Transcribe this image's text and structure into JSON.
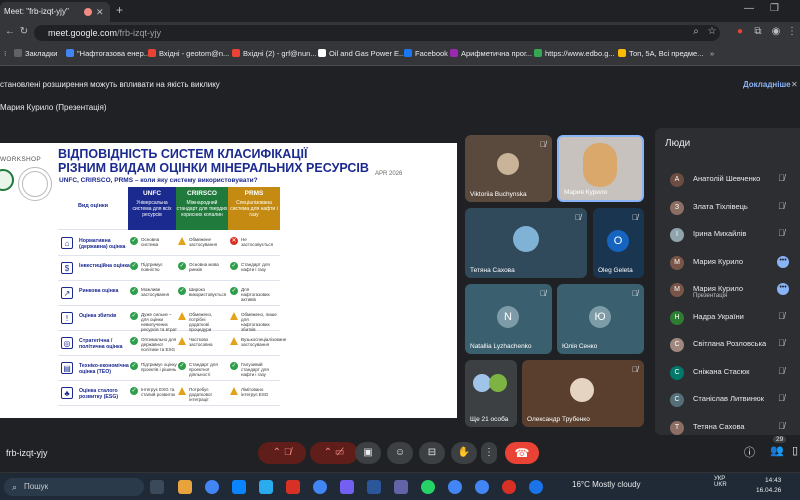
{
  "browser": {
    "tab_title": "Meet: \"frb-izqt-yjy\"",
    "url_host": "meet.google.com",
    "url_path": "/frb-izqt-yjy"
  },
  "bookmarks": [
    {
      "label": "Закладки",
      "color": "#5f6368"
    },
    {
      "label": "\"Нафтогазова енер...",
      "color": "#4285f4"
    },
    {
      "label": "Вхідні - geotom@n...",
      "color": "#ea4335"
    },
    {
      "label": "Вхідні (2) - grf@nun...",
      "color": "#ea4335"
    },
    {
      "label": "Oil and Gas Power E...",
      "color": "#ffffff"
    },
    {
      "label": "Facebook",
      "color": "#1877f2"
    },
    {
      "label": "Арифметична прог...",
      "color": "#9c27b0"
    },
    {
      "label": "https://www.edbo.g...",
      "color": "#34a853"
    },
    {
      "label": "Топ, 5А, Всі предме...",
      "color": "#fbbc04"
    }
  ],
  "notice": {
    "text": "становлені розширення можуть впливати на якість виклику",
    "more": "Докладніше",
    "close": "✕"
  },
  "presenter_label": "Мария Курило (Презентація)",
  "slide": {
    "workshop": "WORKSHOP",
    "title_line1": "ВІДПОВІДНІСТЬ СИСТЕМ КЛАСИФІКАЦІЇ",
    "title_line2": "РІЗНИМ ВИДАМ ОЦІНКИ МІНЕРАЛЬНИХ РЕСУРСІВ",
    "subtitle": "UNFC, CRIRSCO, PRMS – коли яку систему використовувати?",
    "date": "APR 2026",
    "col0": "Вид оцінки",
    "columns": [
      {
        "name": "UNFC",
        "desc": "Універсальна система для всіх ресурсів",
        "color": "#1b2a8f"
      },
      {
        "name": "CRIRSCO",
        "desc": "Міжнародний стандарт для твердих корисних копалин",
        "color": "#1f7a3b"
      },
      {
        "name": "PRMS",
        "desc": "Спеціалізована система для нафти і газу",
        "color": "#c48a12"
      }
    ],
    "rows": [
      {
        "name": "Нормативна (державна) оцінка",
        "icon": "⌂",
        "cells": [
          [
            "ok",
            "Основна система"
          ],
          [
            "warn",
            "Обмежене застосування"
          ],
          [
            "no",
            "Не застосовується"
          ]
        ]
      },
      {
        "name": "Інвестиційна оцінка",
        "icon": "$",
        "cells": [
          [
            "ok",
            "Підтримує повністю"
          ],
          [
            "ok",
            "Основна мова ринків"
          ],
          [
            "ok",
            "Стандарт для нафти і газу"
          ]
        ]
      },
      {
        "name": "Ринкова оцінка",
        "icon": "↗",
        "cells": [
          [
            "ok",
            "Можливе застосування"
          ],
          [
            "ok",
            "Широко використовується"
          ],
          [
            "ok",
            "Для нафтогазових активів"
          ]
        ]
      },
      {
        "name": "Оцінка збитків",
        "icon": "!",
        "cells": [
          [
            "ok",
            "Дуже сильне – для оцінки невилучених ресурсів та втрат"
          ],
          [
            "warn",
            "Обмежено, потрібні додаткові процедури"
          ],
          [
            "warn",
            "Обмежено, лише для нафтогазових збитків"
          ]
        ]
      },
      {
        "name": "Стратегічна / політична оцінка",
        "icon": "◎",
        "cells": [
          [
            "ok",
            "Оптимально для державної політики та ESG"
          ],
          [
            "warn",
            "Частково застосовна"
          ],
          [
            "warn",
            "Вузькоспеціалізоване застосування"
          ]
        ]
      },
      {
        "name": "Техніко-економічна оцінка (ТЕО)",
        "icon": "▤",
        "cells": [
          [
            "ok",
            "Підтримує оцінку проектів і рішень"
          ],
          [
            "ok",
            "Стандарт для проектної діяльності"
          ],
          [
            "ok",
            "Галузевий стандарт для нафти і газу"
          ]
        ]
      },
      {
        "name": "Оцінка сталого розвитку (ESG)",
        "icon": "♣",
        "cells": [
          [
            "ok",
            "Інтегрує ESG та сталий розвиток"
          ],
          [
            "warn",
            "Потребує додаткової інтеграції"
          ],
          [
            "warn",
            "Лімітовано інтегрує ESG"
          ]
        ]
      }
    ]
  },
  "tiles": [
    {
      "name": "Viktoriia Buchynska",
      "mic_muted": true
    },
    {
      "name": "Мария Курило",
      "mic_muted": false
    },
    {
      "name": "Тетяна Сахова",
      "mic_muted": true
    },
    {
      "name": "Oleg Geleta",
      "initial": "O",
      "mic_muted": true
    },
    {
      "name": "Natallia Lyzhachenko",
      "initial": "N",
      "mic_muted": true
    },
    {
      "name": "Юлія Сенко",
      "initial": "Ю",
      "mic_muted": true
    },
    {
      "name": "Ще 21 особа"
    },
    {
      "name": "Олександр Трубенко",
      "mic_muted": true
    }
  ],
  "people_panel": {
    "title": "Люди",
    "list": [
      {
        "name": "Анатолій Шевченко",
        "initial": "А",
        "color": "#6d4c41",
        "action": "mic-off"
      },
      {
        "name": "Злата Тіхлівець",
        "initial": "З",
        "color": "#8d6e63",
        "action": "mic-off"
      },
      {
        "name": "Ірина Михайлів",
        "initial": "І",
        "color": "#90a4ae",
        "action": "mic-off"
      },
      {
        "name": "Мария Курило",
        "initial": "М",
        "color": "#795548",
        "action": "more"
      },
      {
        "name": "Мария Курило",
        "sub": "Презентація",
        "initial": "М",
        "color": "#795548",
        "action": "more"
      },
      {
        "name": "Надра України",
        "initial": "Н",
        "color": "#2e7d32",
        "action": "mic-off"
      },
      {
        "name": "Світлана Розловська",
        "initial": "С",
        "color": "#a1887f",
        "action": "mic-off"
      },
      {
        "name": "Сніжана Стасюк",
        "initial": "С",
        "color": "#00796b",
        "action": "mic-off"
      },
      {
        "name": "Станіслав Литвинюк",
        "initial": "С",
        "color": "#546e7a",
        "action": "mic-off"
      },
      {
        "name": "Тетяна Сахова",
        "initial": "Т",
        "color": "#8d6e63",
        "action": "mic-off"
      }
    ]
  },
  "controls": {
    "meeting_code": "frb-izqt-yjy",
    "people_count": "29"
  },
  "taskbar": {
    "search": "Пошук",
    "weather": "16°C   Mostly cloudy",
    "lang1": "УКР",
    "lang2": "UKR",
    "time": "14:43",
    "date": "16.04.26"
  }
}
